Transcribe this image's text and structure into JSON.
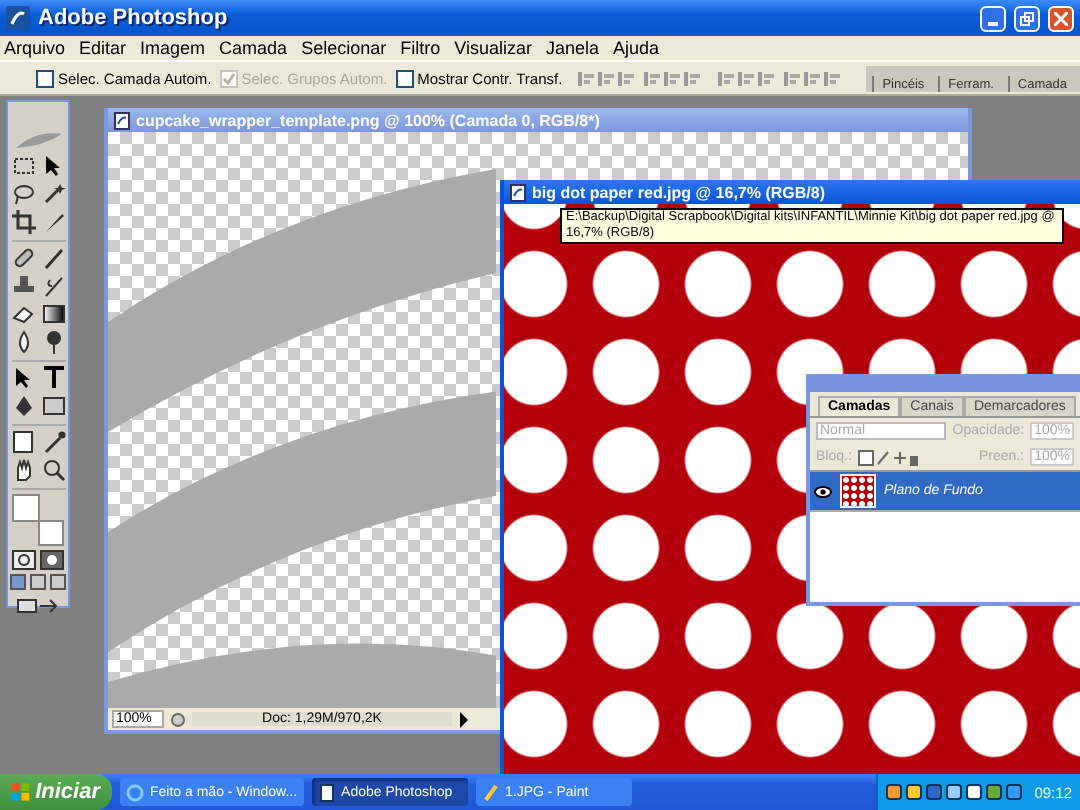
{
  "app": {
    "title": "Adobe Photoshop"
  },
  "menu": [
    "Arquivo",
    "Editar",
    "Imagem",
    "Camada",
    "Selecionar",
    "Filtro",
    "Visualizar",
    "Janela",
    "Ajuda"
  ],
  "options": {
    "checkboxes": [
      {
        "label": "Selec. Camada Autom.",
        "checked": false,
        "disabled": false
      },
      {
        "label": "Selec. Grupos Autom.",
        "checked": true,
        "disabled": true
      },
      {
        "label": "Mostrar Contr. Transf.",
        "checked": false,
        "disabled": false
      }
    ],
    "palette_well": [
      "Pincéis",
      "Ferram.",
      "Camada"
    ]
  },
  "documents": [
    {
      "title": "cupcake_wrapper_template.png @ 100% (Camada 0, RGB/8*)",
      "active": false,
      "kind": "template",
      "zoom": "100%",
      "doc_info": "Doc: 1,29M/970,2K"
    },
    {
      "title": "big dot paper red.jpg @ 16,7% (RGB/8)",
      "active": true,
      "kind": "dots",
      "tooltip": "E:\\Backup\\Digital Scrapbook\\Digital kits\\INFANTIL\\Minnie Kit\\big dot paper red.jpg @ 16,7% (RGB/8)"
    }
  ],
  "layers_panel": {
    "tabs": [
      {
        "label": "Camadas",
        "selected": true
      },
      {
        "label": "Canais",
        "selected": false
      },
      {
        "label": "Demarcadores",
        "selected": false
      }
    ],
    "blend_mode": "Normal",
    "opacity_label": "Opacidade:",
    "opacity": "100%",
    "lock_label": "Bloq.:",
    "fill_label": "Preen.:",
    "fill": "100%",
    "layers": [
      {
        "name": "Plano de Fundo",
        "selected": true,
        "visible": true
      }
    ]
  },
  "taskbar": {
    "start": "Iniciar",
    "tasks": [
      {
        "label": "Feito a mão - Window...",
        "selected": false
      },
      {
        "label": "Adobe Photoshop",
        "selected": true
      },
      {
        "label": "1.JPG - Paint",
        "selected": false
      }
    ],
    "clock": "09:12"
  }
}
